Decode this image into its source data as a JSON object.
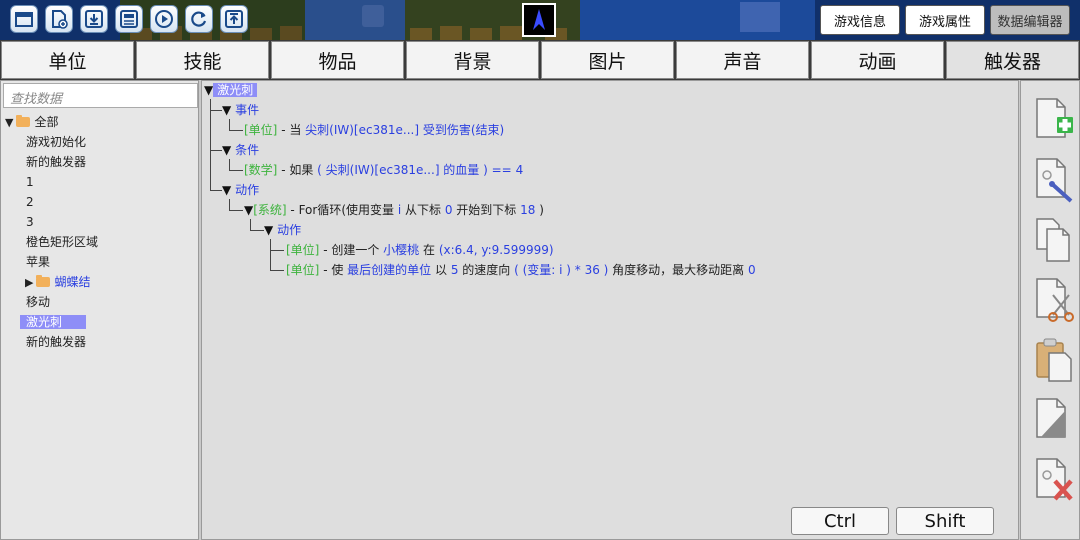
{
  "toolbar": {
    "icons": [
      "folder-open-icon",
      "new-file-icon",
      "download-icon",
      "save-icon",
      "play-icon",
      "refresh-icon",
      "upload-icon"
    ],
    "right_buttons": [
      {
        "label": "游戏信息",
        "enabled": true
      },
      {
        "label": "游戏属性",
        "enabled": true
      },
      {
        "label": "数据编辑器",
        "enabled": false
      }
    ]
  },
  "tabs": [
    {
      "label": "单位"
    },
    {
      "label": "技能"
    },
    {
      "label": "物品"
    },
    {
      "label": "背景"
    },
    {
      "label": "图片"
    },
    {
      "label": "声音"
    },
    {
      "label": "动画"
    },
    {
      "label": "触发器",
      "active": true
    }
  ],
  "left": {
    "search_placeholder": "查找数据",
    "root_label": "全部",
    "items": [
      {
        "label": "游戏初始化"
      },
      {
        "label": "新的触发器"
      },
      {
        "label": "1"
      },
      {
        "label": "2"
      },
      {
        "label": "3"
      },
      {
        "label": "橙色矩形区域"
      },
      {
        "label": "苹果"
      },
      {
        "label": "蝴蝶结"
      },
      {
        "label": "移动"
      },
      {
        "label": "激光刺"
      },
      {
        "label": "新的触发器"
      }
    ]
  },
  "tree": {
    "root": "激光刺",
    "event_header": "事件",
    "event": {
      "category": "[单位]",
      "prefix": " - 当 ",
      "subject": "尖刺(IW)[ec381e...]",
      "action": "受到伤害(结束)"
    },
    "condition_header": "条件",
    "condition": {
      "category": "[数学]",
      "prefix": " - 如果 ",
      "expr": "( 尖刺(IW)[ec381e...] 的血量 )",
      "op": " == ",
      "value": "4"
    },
    "action_header": "动作",
    "loop": {
      "category": "[系统]",
      "prefix": " - For循环(使用变量 ",
      "var": "i",
      "mid1": " 从下标 ",
      "from": "0",
      "mid2": " 开始到下标 ",
      "to": "18",
      "suffix": " )"
    },
    "sub_action_header": "动作",
    "create": {
      "category": "[单位]",
      "prefix": " - 创建一个 ",
      "unit": "小樱桃",
      "mid": " 在 ",
      "pos": "(x:6.4, y:9.599999)"
    },
    "move": {
      "category": "[单位]",
      "prefix": " - 使 ",
      "unit": "最后创建的单位",
      "mid1": " 以 ",
      "speed": "5",
      "mid2": " 的速度向 ",
      "angle": "( (变量: i ) * 36 )",
      "mid3": " 角度移动，最大移动距离 ",
      "dist": "0"
    }
  },
  "keys": {
    "ctrl": "Ctrl",
    "shift": "Shift"
  },
  "right_tools": [
    "add-doc-icon",
    "edit-doc-icon",
    "copy-doc-icon",
    "cut-doc-icon",
    "paste-doc-icon",
    "blank-doc-icon",
    "delete-doc-icon"
  ]
}
